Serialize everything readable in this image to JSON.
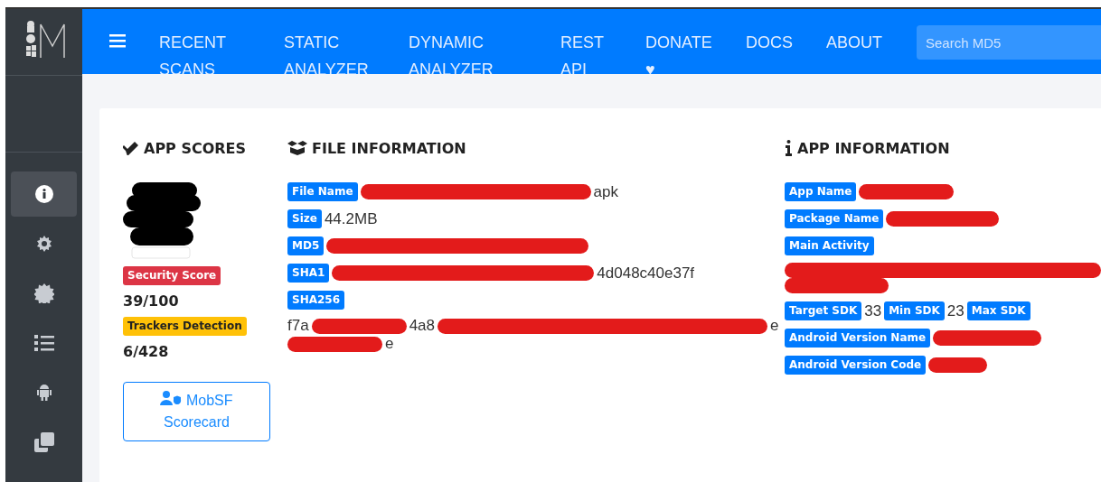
{
  "nav": {
    "items": [
      {
        "label": "RECENT SCANS"
      },
      {
        "label": "STATIC ANALYZER"
      },
      {
        "label": "DYNAMIC ANALYZER"
      },
      {
        "label": "REST API"
      },
      {
        "label": "DONATE ♥"
      },
      {
        "label": "DOCS"
      },
      {
        "label": "ABOUT"
      }
    ],
    "search": {
      "placeholder": "Search MD5"
    }
  },
  "sidebar": {
    "items": [
      {
        "selected": true
      },
      {
        "selected": false
      },
      {
        "selected": false
      },
      {
        "selected": false
      },
      {
        "selected": false
      },
      {
        "selected": false
      }
    ]
  },
  "scores": {
    "title": "APP SCORES",
    "security": {
      "label": "Security Score",
      "value": "39/100"
    },
    "trackers": {
      "label": "Trackers Detection",
      "value": "6/428"
    },
    "scorecard": "MobSF Scorecard"
  },
  "file_info": {
    "title": "FILE INFORMATION",
    "fields": [
      {
        "label": "File Name",
        "value": [
          {
            "kind": "redacted"
          },
          {
            "kind": "text",
            "text": "apk"
          }
        ]
      },
      {
        "label": "Size",
        "value": [
          {
            "kind": "text",
            "text": "44.2MB"
          }
        ]
      },
      {
        "label": "MD5",
        "value": [
          {
            "kind": "redacted"
          }
        ]
      },
      {
        "label": "SHA1",
        "value": [
          {
            "kind": "redacted"
          },
          {
            "kind": "text",
            "text": "4d048c40e37f"
          }
        ]
      },
      {
        "label": "SHA256",
        "value": [
          {
            "kind": "text",
            "text": "f7a"
          },
          {
            "kind": "redacted"
          },
          {
            "kind": "text",
            "text": "4a8"
          },
          {
            "kind": "redacted"
          },
          {
            "kind": "text",
            "text": "e"
          },
          {
            "kind": "redacted"
          },
          {
            "kind": "text",
            "text": "e"
          }
        ]
      }
    ]
  },
  "app_info": {
    "title": "APP INFORMATION",
    "fields": [
      {
        "label": "App Name",
        "value": [
          {
            "kind": "redacted"
          }
        ]
      },
      {
        "label": "Package Name",
        "value": [
          {
            "kind": "redacted"
          }
        ]
      },
      {
        "label": "Main Activity",
        "value": [
          {
            "kind": "redacted"
          },
          {
            "kind": "redacted"
          }
        ]
      }
    ],
    "sdk": [
      {
        "label": "Target SDK",
        "value": "33"
      },
      {
        "label": "Min SDK",
        "value": "23"
      },
      {
        "label": "Max SDK"
      }
    ],
    "versions": [
      {
        "label": "Android Version Name",
        "value": [
          {
            "kind": "redacted"
          }
        ]
      },
      {
        "label": "Android Version Code",
        "value": [
          {
            "kind": "redacted"
          }
        ]
      }
    ]
  }
}
